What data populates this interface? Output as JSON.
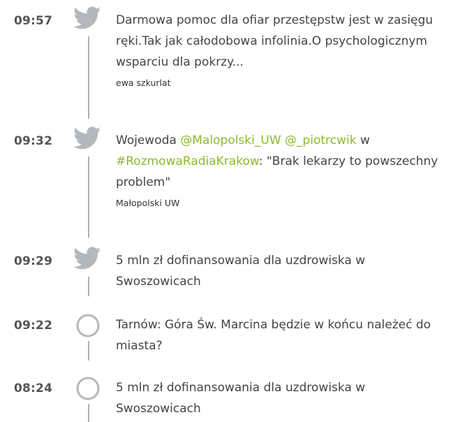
{
  "feed": {
    "entries": [
      {
        "time": "09:57",
        "icon": "twitter-bird-icon",
        "text": "Darmowa pomoc dla ofiar przestępstw jest w zasięgu ręki.Tak jak całodobowa infolinia.O psychologicznym wsparciu dla pokrzy...",
        "author": "ewa szkurlat"
      },
      {
        "time": "09:32",
        "icon": "twitter-bird-icon",
        "text_before": "Wojewoda ",
        "mention_1": "@Malopolski_UW",
        "space_1": " ",
        "mention_2": "@_piotrcwik",
        "text_mid": " w ",
        "hashtag": "#RozmowaRadiaKrakow",
        "text_after": ": \"Brak lekarzy to powszechny problem\"",
        "author": "Małopolski UW"
      },
      {
        "time": "09:29",
        "icon": "twitter-bird-icon",
        "text": "5 mln zł dofinansowania dla uzdrowiska w Swoszowicach"
      },
      {
        "time": "09:22",
        "icon": "circle-icon",
        "text": "Tarnów: Góra Św. Marcina będzie w końcu należeć do miasta?"
      },
      {
        "time": "08:24",
        "icon": "circle-icon",
        "text": "5 mln zł dofinansowania dla uzdrowiska w Swoszowicach"
      }
    ]
  },
  "colors": {
    "time": "#555555",
    "text": "#444444",
    "link": "#8cba2a",
    "icon": "#b3b8bd",
    "line": "#b0b0b0"
  }
}
